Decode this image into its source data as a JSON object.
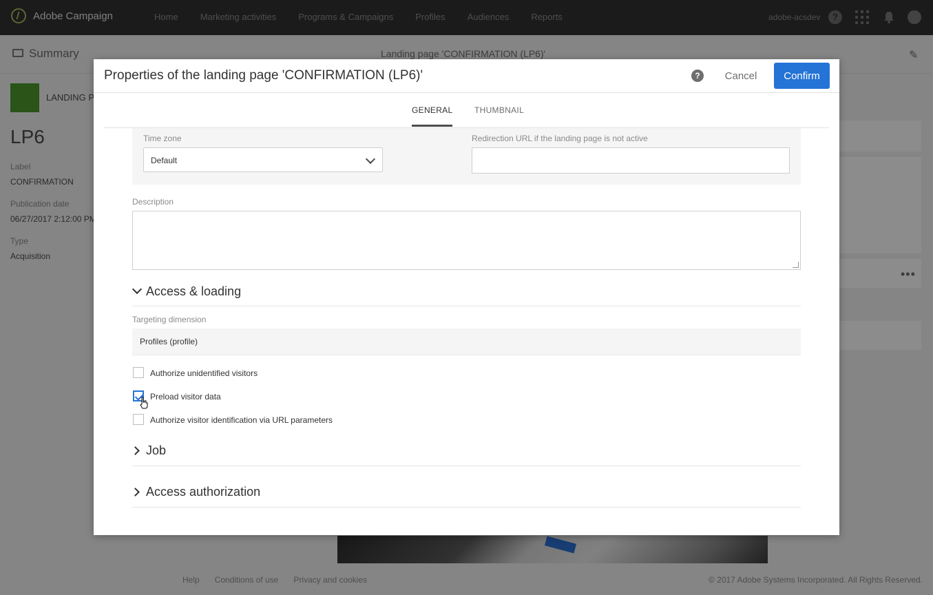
{
  "header": {
    "app_name": "Adobe Campaign",
    "nav": [
      "Home",
      "Marketing activities",
      "Programs & Campaigns",
      "Profiles",
      "Audiences",
      "Reports"
    ],
    "tenant": "adobe-acsdev",
    "help_glyph": "?"
  },
  "page": {
    "summary": "Summary",
    "breadcrumb": "Landing page 'CONFIRMATION (LP6)'",
    "badge_label": "LANDING PA",
    "id": "LP6",
    "label_label": "Label",
    "label_value": "CONFIRMATION",
    "publication_label": "Publication date",
    "publication_value": "06/27/2017 2:12:00 PM",
    "type_label": "Type",
    "type_value": "Acquisition",
    "ellipsis": "•••"
  },
  "footer": {
    "links": [
      "Help",
      "Conditions of use",
      "Privacy and cookies"
    ],
    "copyright": "© 2017 Adobe Systems Incorporated. All Rights Reserved."
  },
  "dialog": {
    "title": "Properties of the landing page 'CONFIRMATION (LP6)'",
    "help_glyph": "?",
    "cancel": "Cancel",
    "confirm": "Confirm",
    "tabs": [
      "GENERAL",
      "THUMBNAIL"
    ],
    "active_tab": "GENERAL",
    "timezone": {
      "label": "Time zone",
      "value": "Default"
    },
    "redirect": {
      "label": "Redirection URL if the landing page is not active",
      "value": ""
    },
    "description": {
      "label": "Description",
      "value": ""
    },
    "access_section": {
      "title": "Access & loading",
      "expanded": true,
      "targeting_label": "Targeting dimension",
      "targeting_value": "Profiles (profile)",
      "checkboxes": [
        {
          "label": "Authorize unidentified visitors",
          "checked": false
        },
        {
          "label": "Preload visitor data",
          "checked": true
        },
        {
          "label": "Authorize visitor identification via URL parameters",
          "checked": false
        }
      ]
    },
    "job_section": {
      "title": "Job",
      "expanded": false
    },
    "auth_section": {
      "title": "Access authorization",
      "expanded": false
    }
  },
  "colors": {
    "topbar": "#323232",
    "primary": "#2473d6",
    "badge": "#4e9a2c"
  }
}
